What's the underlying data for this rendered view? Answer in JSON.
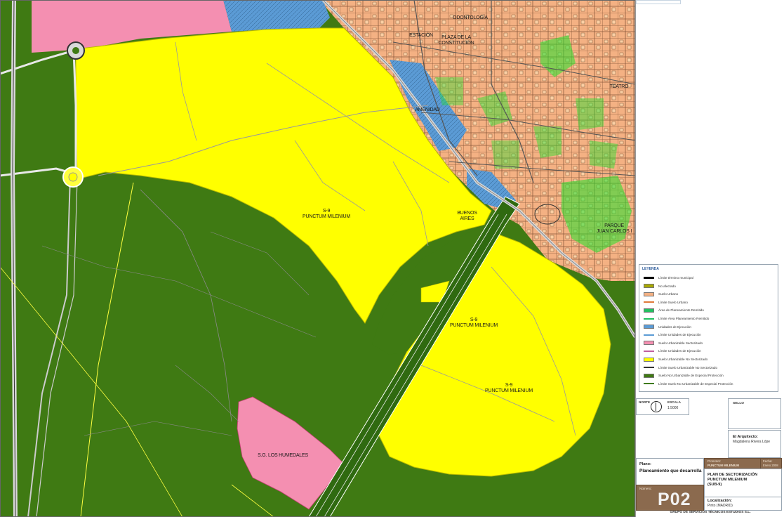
{
  "map": {
    "colors": {
      "yellow": "#ffff00",
      "green": "#3f7a13",
      "pink": "#f48fb1",
      "blue": "#5b9bd5",
      "urban": "#f4b183",
      "park": "#22e22c"
    },
    "labels": {
      "sector_1": "S-9\nPUNCTUM MILENIUM",
      "sector_2": "S-9\nPUNCTUM MILENIUM",
      "sector_3": "S-9\nPUNCTUM MILENIUM",
      "humedales": "S.G. LOS HUMEDALES",
      "parque": "PARQUE\nJUAN CARLOS I",
      "buenos_aires": "BUENOS\nAIRES",
      "amenidad": "AMENIDAD",
      "estacion": "ESTACIÓN",
      "plaza": "PLAZA DE LA\nCONSTITUCIÓN",
      "teatro": "TEATRO",
      "odontologia": "ODONTOLOGÍA"
    }
  },
  "legend": {
    "title": "LEYENDA",
    "items": [
      {
        "label": "Límite término municipal",
        "color": "#000000",
        "kind": "line"
      },
      {
        "label": "No afectado",
        "color": "#a8a800",
        "kind": "box"
      },
      {
        "label": "Suelo Urbano",
        "color": "#f4b183",
        "kind": "box"
      },
      {
        "label": "Límite Suelo Urbano",
        "color": "#e07a3a",
        "kind": "line"
      },
      {
        "label": "Área de Planeamiento Remitido",
        "color": "#22c060",
        "kind": "box"
      },
      {
        "label": "Límite Área Planeamiento Remitido",
        "color": "#22c060",
        "kind": "line"
      },
      {
        "label": "Unidades de Ejecución",
        "color": "#5b9bd5",
        "kind": "box"
      },
      {
        "label": "Límite Unidades de Ejecución",
        "color": "#5b9bd5",
        "kind": "line"
      },
      {
        "label": "Suelo Urbanizable Sectorizado",
        "color": "#f48fb1",
        "kind": "box"
      },
      {
        "label": "Límite Unidades de Ejecución",
        "color": "#c060a0",
        "kind": "line"
      },
      {
        "label": "Suelo Urbanizable No Sectorizado",
        "color": "#ffff00",
        "kind": "box"
      },
      {
        "label": "Límite Suelo Urbanizable No Sectorizado",
        "color": "#333333",
        "kind": "line"
      },
      {
        "label": "Suelo No Urbanizable de Especial Protección",
        "color": "#3f7a13",
        "kind": "box"
      },
      {
        "label": "Límite Suelo No Urbanizable de Especial Protección",
        "color": "#3f7a13",
        "kind": "line"
      }
    ]
  },
  "north": {
    "label": "NORTE"
  },
  "scale": {
    "label": "ESCALA",
    "value": "1:5000"
  },
  "stamp": {
    "label": "SELLO"
  },
  "architect": {
    "label": "El Arquitecto:",
    "name": "Magdalena Rivera Lópe"
  },
  "promoter": {
    "label": "Promotor:",
    "value": "PUNCTUM MILENIUM"
  },
  "fecha": {
    "label": "Fecha:",
    "value": "Enero 2008"
  },
  "plano": {
    "label": "Plano:",
    "title": "Planeamiento que desarrolla"
  },
  "project": {
    "line1": "PLAN DE SECTORIZACIÓN",
    "line2": "PUNCTUM MILENIUM",
    "line3": "(SUB-9)"
  },
  "number": {
    "label": "Número:",
    "value": "P02"
  },
  "location": {
    "label": "Localización:",
    "value": "Pinto (MADRID)"
  },
  "company": "GRUPO DE SERVICIOS TÉCNICOS ESTUDIOS S.L."
}
